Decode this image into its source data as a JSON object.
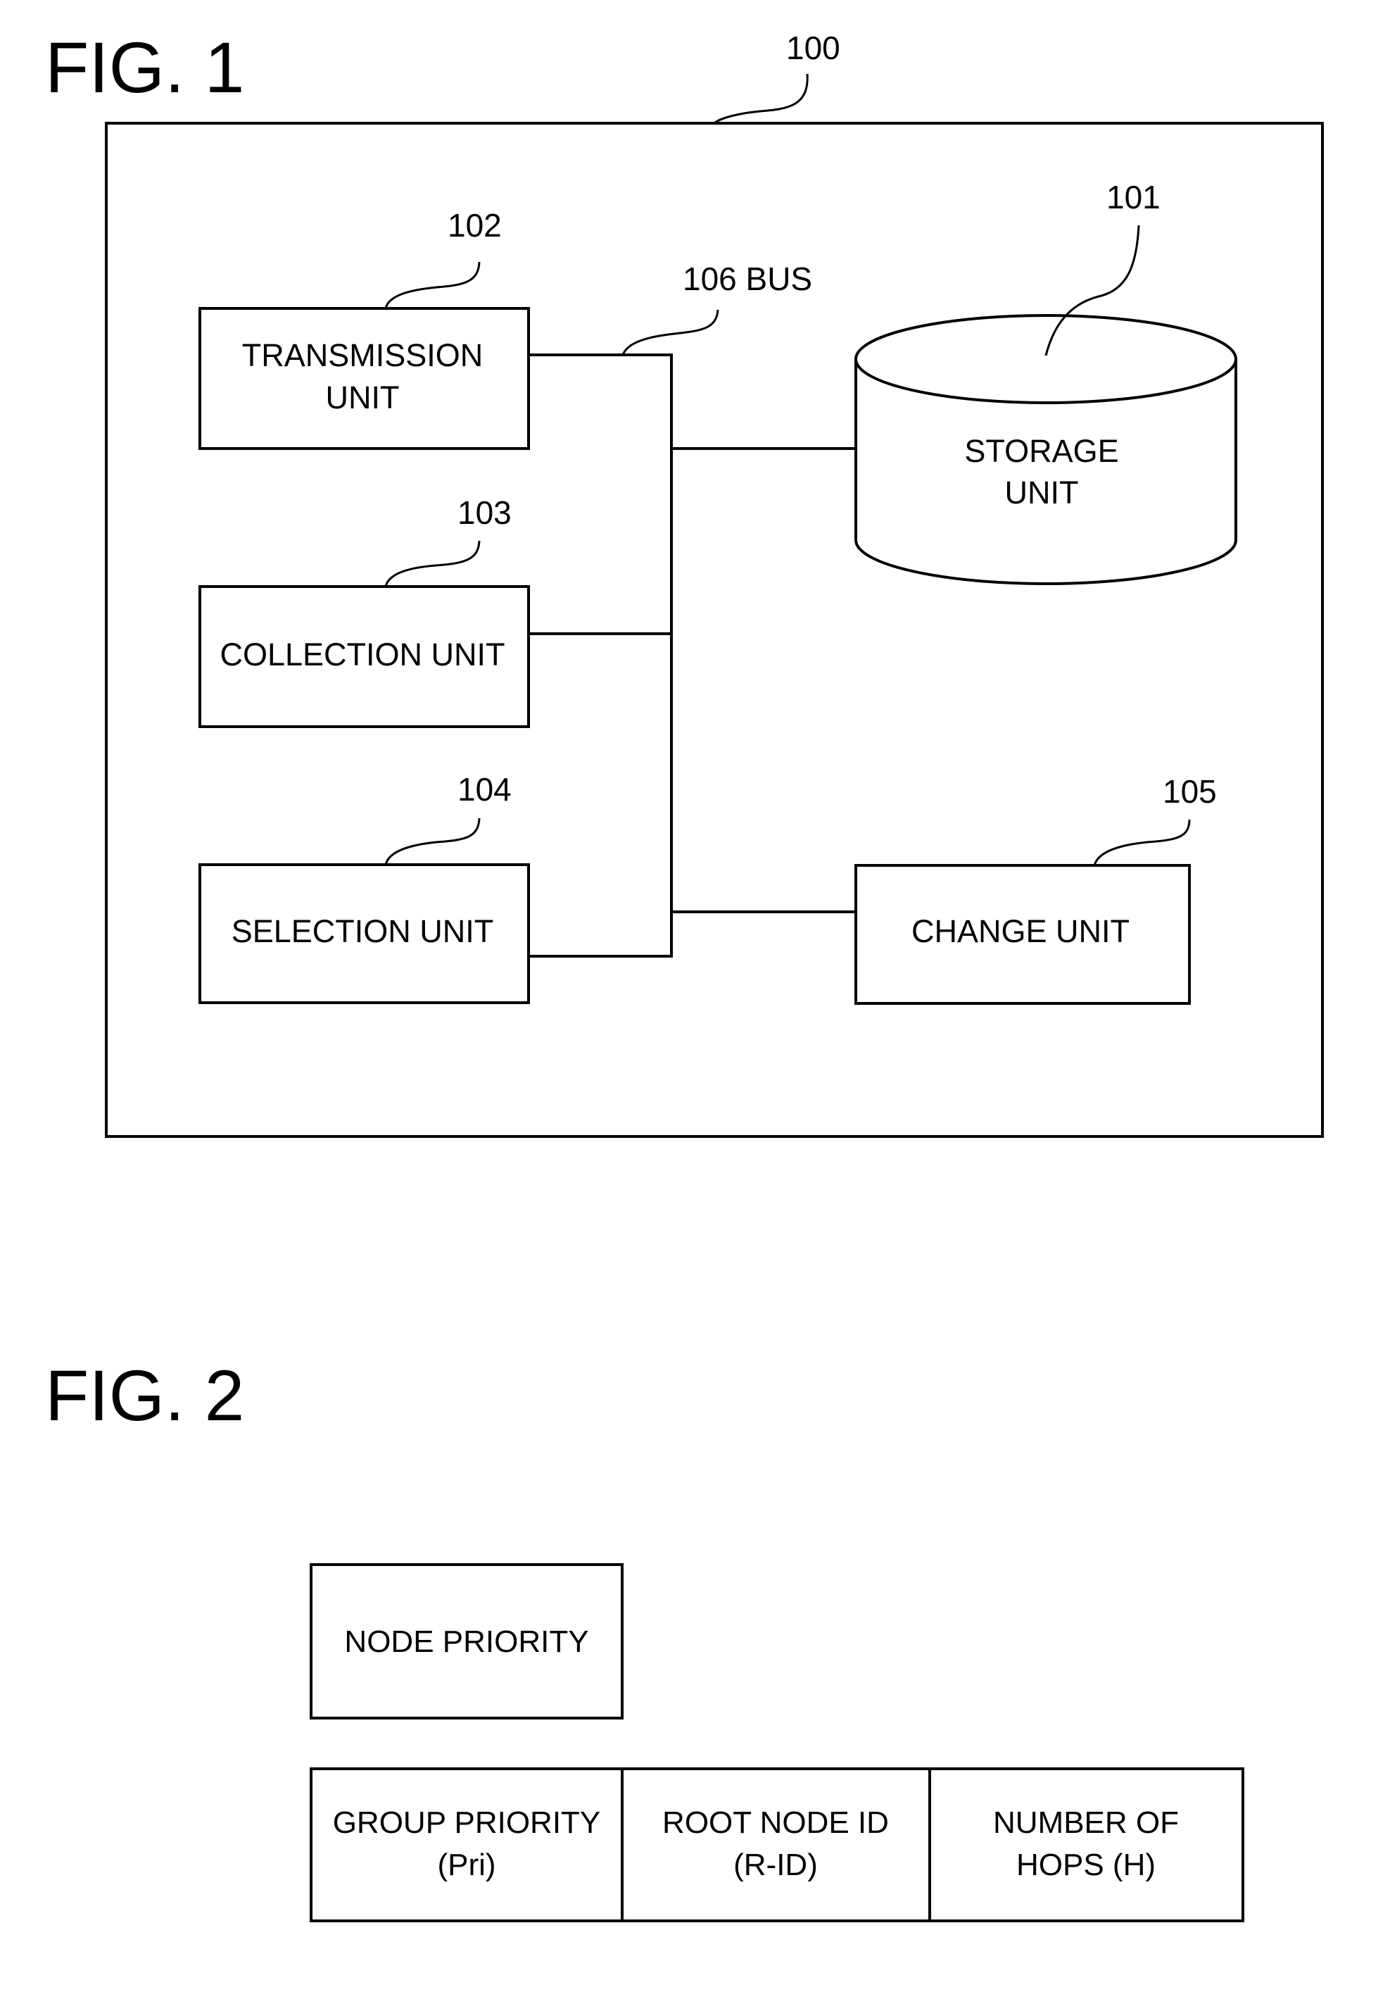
{
  "figures": [
    {
      "title": "FIG. 1",
      "container": {
        "ref": "100"
      },
      "units": [
        {
          "id": "storage",
          "ref": "101",
          "lines": [
            "STORAGE",
            "UNIT"
          ],
          "shape": "cylinder"
        },
        {
          "id": "transmission",
          "ref": "102",
          "lines": [
            "TRANSMISSION",
            "UNIT"
          ],
          "shape": "box"
        },
        {
          "id": "collection",
          "ref": "103",
          "lines": [
            "COLLECTION UNIT"
          ],
          "shape": "box"
        },
        {
          "id": "selection",
          "ref": "104",
          "lines": [
            "SELECTION UNIT"
          ],
          "shape": "box"
        },
        {
          "id": "change",
          "ref": "105",
          "lines": [
            "CHANGE UNIT"
          ],
          "shape": "box"
        }
      ],
      "bus": {
        "label": "106 BUS"
      },
      "connections": [
        [
          "transmission",
          "bus"
        ],
        [
          "collection",
          "bus"
        ],
        [
          "selection",
          "bus"
        ],
        [
          "bus",
          "storage"
        ],
        [
          "bus",
          "change"
        ]
      ]
    },
    {
      "title": "FIG. 2",
      "node_field": {
        "lines": [
          "NODE PRIORITY"
        ]
      },
      "group_fields": [
        {
          "lines": [
            "GROUP PRIORITY",
            "(Pri)"
          ]
        },
        {
          "lines": [
            "ROOT NODE ID",
            "(R-ID)"
          ]
        },
        {
          "lines": [
            "NUMBER OF",
            "HOPS (H)"
          ]
        }
      ]
    }
  ]
}
